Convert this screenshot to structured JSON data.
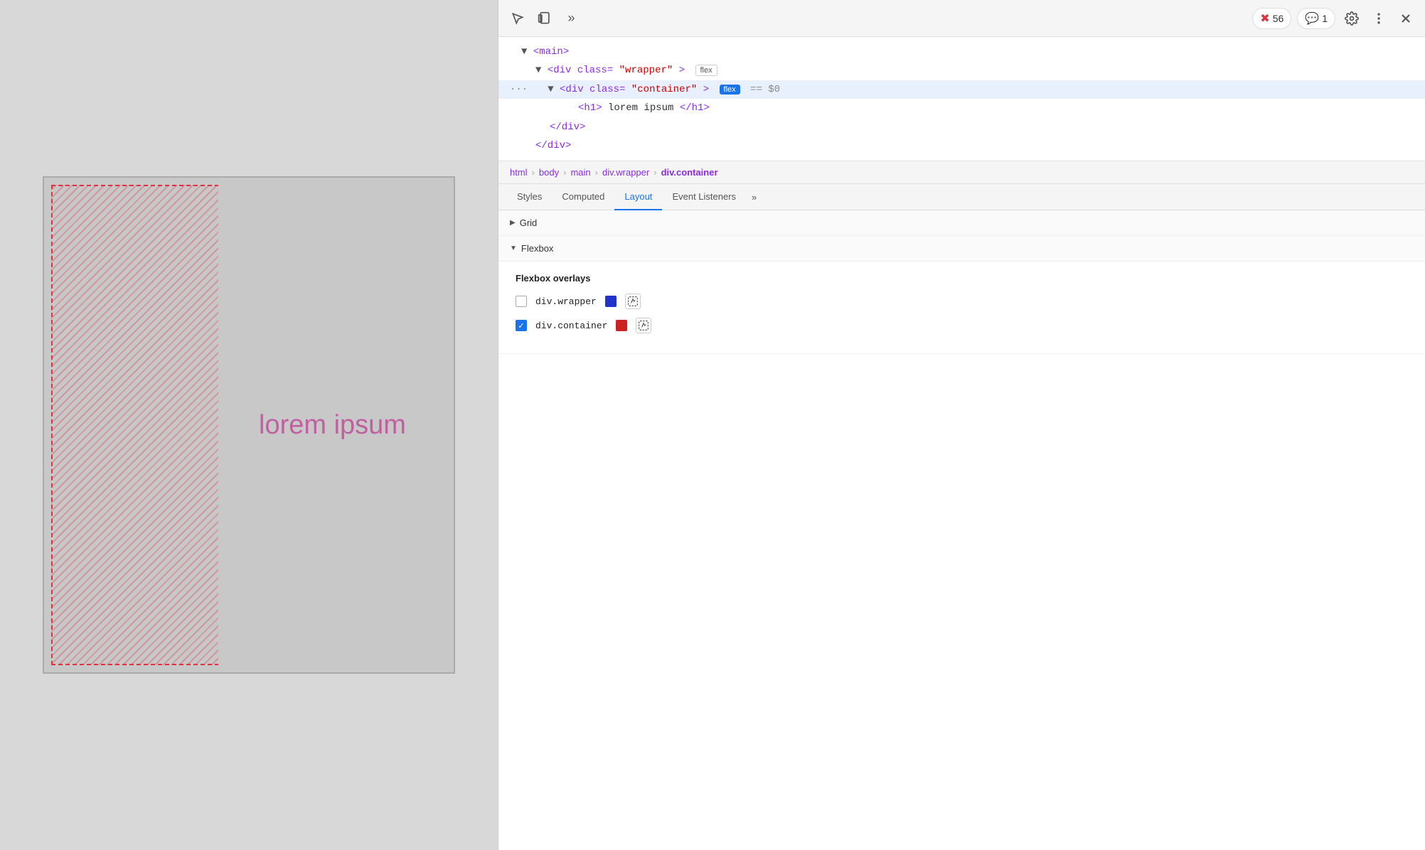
{
  "preview": {
    "lorem_text": "lorem ipsum"
  },
  "devtools": {
    "toolbar": {
      "inspect_icon": "inspect",
      "device_icon": "device",
      "more_icon": "more",
      "settings_icon": "settings",
      "menu_icon": "menu",
      "close_icon": "close",
      "error_count": "56",
      "message_count": "1"
    },
    "html_tree": {
      "lines": [
        {
          "indent": 0,
          "html": "▼<main>",
          "selected": false
        },
        {
          "indent": 1,
          "html": "▼<div class=\"wrapper\">",
          "badge": "flex",
          "badge_type": "outline",
          "selected": false
        },
        {
          "indent": 2,
          "html": "<div class=\"container\">",
          "badge": "flex",
          "badge_type": "filled",
          "dollar": "== $0",
          "selected": true,
          "has_dots": true
        },
        {
          "indent": 3,
          "html": "<h1>lorem ipsum</h1>",
          "selected": false
        },
        {
          "indent": 2,
          "html": "</div>",
          "selected": false
        },
        {
          "indent": 1,
          "html": "</div>",
          "selected": false
        }
      ]
    },
    "breadcrumb": {
      "items": [
        "html",
        "body",
        "main",
        "div.wrapper",
        "div.container"
      ]
    },
    "tabs": {
      "items": [
        "Styles",
        "Computed",
        "Layout",
        "Event Listeners"
      ],
      "active": "Layout"
    },
    "layout": {
      "grid_section": {
        "label": "Grid",
        "expanded": false
      },
      "flexbox_section": {
        "label": "Flexbox",
        "expanded": true,
        "overlays_title": "Flexbox overlays",
        "overlays": [
          {
            "label": "div.wrapper",
            "checked": false,
            "color": "#2233cc",
            "id": "wrapper"
          },
          {
            "label": "div.container",
            "checked": true,
            "color": "#cc2222",
            "id": "container"
          }
        ]
      }
    }
  }
}
